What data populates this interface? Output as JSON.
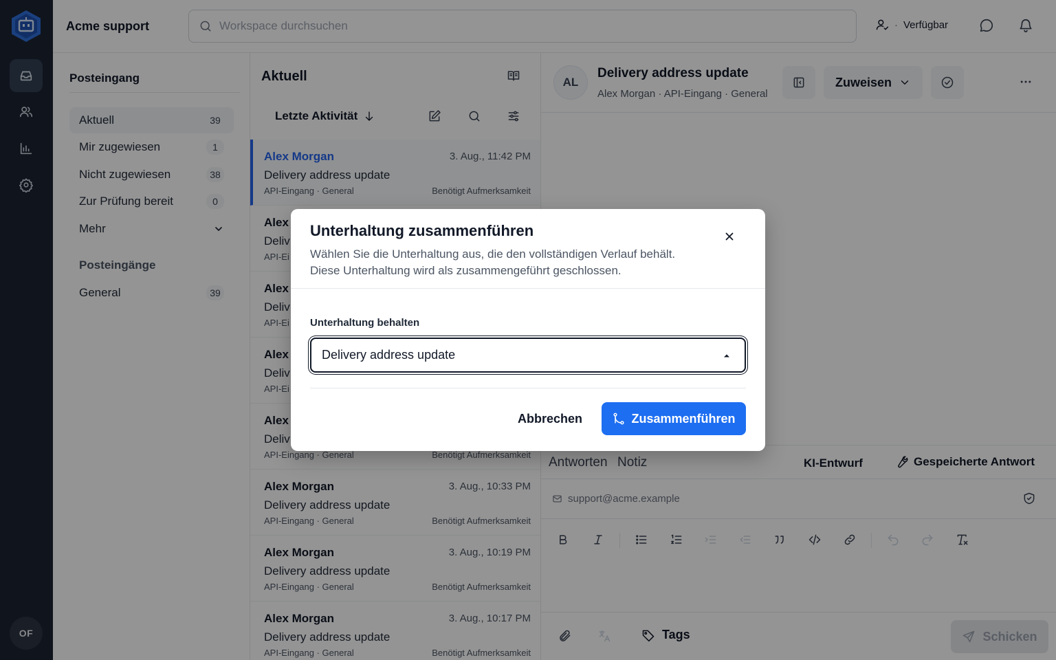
{
  "app": {
    "brand": "Acme support"
  },
  "header": {
    "search_placeholder": "Workspace durchsuchen",
    "status_label": "Verfügbar",
    "status_sep": "·"
  },
  "rail": {
    "user_initials": "OF"
  },
  "sidebar": {
    "title": "Posteingang",
    "items": [
      {
        "label": "Aktuell",
        "count": "39"
      },
      {
        "label": "Mir zugewiesen",
        "count": "1"
      },
      {
        "label": "Nicht zugewiesen",
        "count": "38"
      },
      {
        "label": "Zur Prüfung bereit",
        "count": "0"
      },
      {
        "label": "Mehr"
      }
    ],
    "section_title": "Posteingänge",
    "inboxes": [
      {
        "label": "General",
        "count": "39"
      }
    ]
  },
  "list": {
    "title": "Aktuell",
    "sort_label": "Letzte Aktivität",
    "rows": [
      {
        "name": "Alex Morgan",
        "time": "3. Aug., 11:42 PM",
        "subject": "Delivery address update",
        "meta": "API-Eingang · General",
        "flag": "Benötigt Aufmerksamkeit"
      },
      {
        "name": "Alex",
        "time": "",
        "subject": "Deliv",
        "meta": "API-Ei",
        "flag": ""
      },
      {
        "name": "Alex",
        "time": "",
        "subject": "Deliv",
        "meta": "API-Ei",
        "flag": ""
      },
      {
        "name": "Alex",
        "time": "",
        "subject": "Deliv",
        "meta": "API-Ei",
        "flag": ""
      },
      {
        "name": "Alex",
        "time": "",
        "subject": "Deliv",
        "meta": "API-Eingang · General",
        "flag": "Benötigt Aufmerksamkeit"
      },
      {
        "name": "Alex Morgan",
        "time": "3. Aug., 10:33 PM",
        "subject": "Delivery address update",
        "meta": "API-Eingang · General",
        "flag": "Benötigt Aufmerksamkeit"
      },
      {
        "name": "Alex Morgan",
        "time": "3. Aug., 10:19 PM",
        "subject": "Delivery address update",
        "meta": "API-Eingang · General",
        "flag": "Benötigt Aufmerksamkeit"
      },
      {
        "name": "Alex Morgan",
        "time": "3. Aug., 10:17 PM",
        "subject": "Delivery address update",
        "meta": "API-Eingang · General",
        "flag": "Benötigt Aufmerksamkeit"
      }
    ]
  },
  "conversation": {
    "avatar": "AL",
    "title": "Delivery address update",
    "meta": "Alex Morgan  ·  API-Eingang  ·  General",
    "assign_label": "Zuweisen",
    "reply_tab": "Antworten",
    "note_tab": "Notiz",
    "ai_draft": "KI-Entwurf",
    "saved_reply": "Gespeicherte Antwort",
    "from_address": "support@acme.example",
    "tags_label": "Tags",
    "send_label": "Schicken"
  },
  "modal": {
    "title": "Unterhaltung zusammenführen",
    "desc_line1": "Wählen Sie die Unterhaltung aus, die den vollständigen Verlauf behält.",
    "desc_line2": "Diese Unterhaltung wird als zusammengeführt geschlossen.",
    "field_label": "Unterhaltung behalten",
    "selected_value": "Delivery address update",
    "cancel_label": "Abbrechen",
    "merge_label": "Zusammenführen"
  },
  "colors": {
    "primary": "#1d6ef1",
    "rail": "#1c2431",
    "active_link": "#2563eb"
  }
}
